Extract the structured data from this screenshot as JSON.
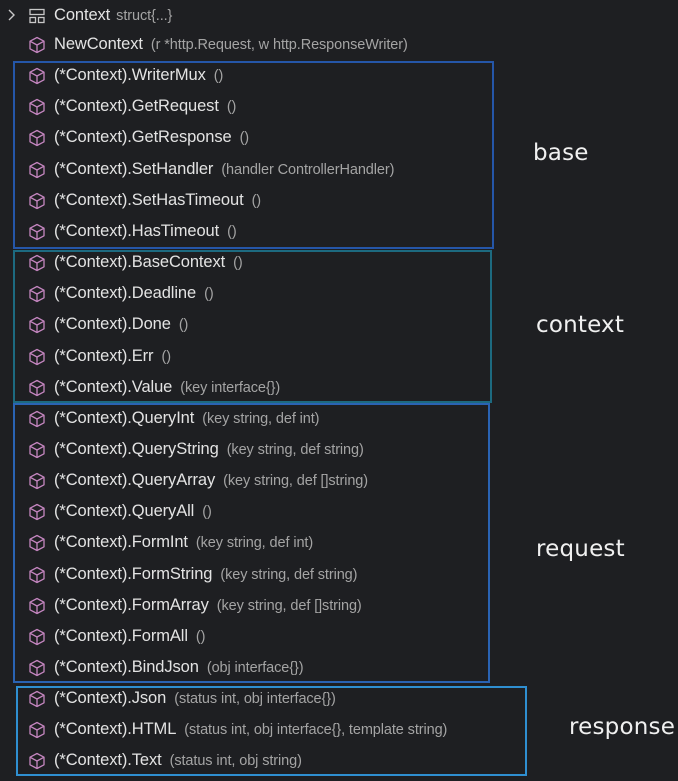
{
  "outline": {
    "root": {
      "name": "Context",
      "detail": "struct{...}",
      "icon": "struct-icon",
      "toggle_icon": "chevron-right-icon"
    },
    "items": [
      {
        "name": "NewContext",
        "detail": "(r *http.Request, w http.ResponseWriter)"
      },
      {
        "name": "(*Context).WriterMux",
        "detail": "()"
      },
      {
        "name": "(*Context).GetRequest",
        "detail": "()"
      },
      {
        "name": "(*Context).GetResponse",
        "detail": "()"
      },
      {
        "name": "(*Context).SetHandler",
        "detail": "(handler ControllerHandler)"
      },
      {
        "name": "(*Context).SetHasTimeout",
        "detail": "()"
      },
      {
        "name": "(*Context).HasTimeout",
        "detail": "()"
      },
      {
        "name": "(*Context).BaseContext",
        "detail": "()"
      },
      {
        "name": "(*Context).Deadline",
        "detail": "()"
      },
      {
        "name": "(*Context).Done",
        "detail": "()"
      },
      {
        "name": "(*Context).Err",
        "detail": "()"
      },
      {
        "name": "(*Context).Value",
        "detail": "(key interface{})"
      },
      {
        "name": "(*Context).QueryInt",
        "detail": "(key string, def int)"
      },
      {
        "name": "(*Context).QueryString",
        "detail": "(key string, def string)"
      },
      {
        "name": "(*Context).QueryArray",
        "detail": "(key string, def []string)"
      },
      {
        "name": "(*Context).QueryAll",
        "detail": "()"
      },
      {
        "name": "(*Context).FormInt",
        "detail": "(key string, def int)"
      },
      {
        "name": "(*Context).FormString",
        "detail": "(key string, def string)"
      },
      {
        "name": "(*Context).FormArray",
        "detail": "(key string, def []string)"
      },
      {
        "name": "(*Context).FormAll",
        "detail": "()"
      },
      {
        "name": "(*Context).BindJson",
        "detail": "(obj interface{})"
      },
      {
        "name": "(*Context).Json",
        "detail": "(status int, obj interface{})"
      },
      {
        "name": "(*Context).HTML",
        "detail": "(status int, obj interface{}, template string)"
      },
      {
        "name": "(*Context).Text",
        "detail": "(status int, obj string)"
      }
    ],
    "item_icon": "method-cube-icon"
  },
  "groups": [
    {
      "label": "base",
      "color": "#2556a8"
    },
    {
      "label": "context",
      "color": "#1d6a80"
    },
    {
      "label": "request",
      "color": "#2a63b3"
    },
    {
      "label": "response",
      "color": "#2f8fd1"
    }
  ],
  "colors": {
    "background": "#1e1f22",
    "name_text": "#e3e3e3",
    "detail_text": "#a4a4a4",
    "icon": "#c586c0"
  }
}
